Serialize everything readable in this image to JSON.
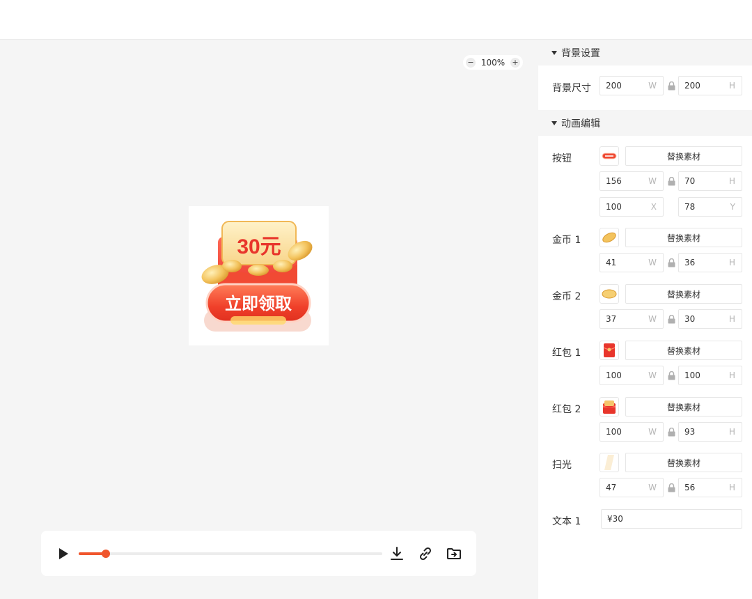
{
  "canvas": {
    "zoom_label": "100%",
    "zoom_out": "−",
    "zoom_in": "+",
    "preview": {
      "amount": "30元",
      "cta": "立即领取"
    }
  },
  "player": {
    "progress": 0.09,
    "icons": [
      "play-icon",
      "download-icon",
      "link-icon",
      "export-folder-icon"
    ]
  },
  "panel": {
    "background": {
      "title": "背景设置",
      "size_label": "背景尺寸",
      "width": "200",
      "height": "200",
      "w_unit": "W",
      "h_unit": "H"
    },
    "animation": {
      "title": "动画编辑",
      "replace_label": "替换素材",
      "button": {
        "label": "按钮",
        "w": "156",
        "h": "70",
        "x": "100",
        "y": "78"
      },
      "coin1": {
        "label": "金币 1",
        "w": "41",
        "h": "36"
      },
      "coin2": {
        "label": "金币 2",
        "w": "37",
        "h": "30"
      },
      "redpack1": {
        "label": "红包 1",
        "w": "100",
        "h": "100"
      },
      "redpack2": {
        "label": "红包 2",
        "w": "100",
        "h": "93"
      },
      "shine": {
        "label": "扫光",
        "w": "47",
        "h": "56"
      },
      "text1": {
        "label": "文本 1",
        "value": "¥30"
      },
      "units": {
        "w": "W",
        "h": "H",
        "x": "X",
        "y": "Y"
      }
    }
  },
  "colors": {
    "accent": "#f0562d",
    "red": "#e8352b",
    "gold": "#f6c56b",
    "panel_bg": "#f5f5f5"
  }
}
